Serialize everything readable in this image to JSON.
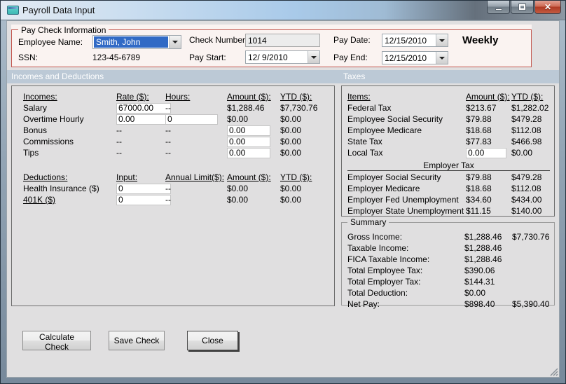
{
  "colors": {
    "selection": "#316AC5",
    "band": "#BCC9D6",
    "groupborder": "#C3574F",
    "groupbg": "#FAF3F1",
    "clientbg": "#E0DFE0"
  },
  "window": {
    "title": "Payroll Data Input"
  },
  "paycheck_info": {
    "legend": "Pay Check Information",
    "employee_name_label": "Employee Name:",
    "employee_name_value": "Smith, John",
    "ssn_label": "SSN:",
    "ssn_value": "123-45-6789",
    "check_number_label": "Check Number:",
    "check_number_value": "1014",
    "pay_start_label": "Pay Start:",
    "pay_start_value": "12/ 9/2010",
    "pay_date_label": "Pay Date:",
    "pay_date_value": "12/15/2010",
    "pay_end_label": "Pay End:",
    "pay_end_value": "12/15/2010",
    "frequency": "Weekly"
  },
  "sections": {
    "incomes_deductions": "Incomes and Deductions",
    "taxes": "Taxes"
  },
  "incomes": {
    "headers": [
      "Incomes:",
      "Rate ($):",
      "Hours:",
      "Amount ($):",
      "YTD ($):"
    ],
    "rows": [
      {
        "name": "Salary",
        "rate": "67000.00",
        "hours": "--",
        "amount": "$1,288.46",
        "ytd": "$7,730.76"
      },
      {
        "name": "Overtime Hourly",
        "rate": "0.00",
        "hours": "0",
        "amount": "$0.00",
        "ytd": "$0.00"
      },
      {
        "name": "Bonus",
        "rate": "--",
        "hours": "--",
        "amount": "0.00",
        "ytd": "$0.00"
      },
      {
        "name": "Commissions",
        "rate": "--",
        "hours": "--",
        "amount": "0.00",
        "ytd": "$0.00"
      },
      {
        "name": "Tips",
        "rate": "--",
        "hours": "--",
        "amount": "0.00",
        "ytd": "$0.00"
      }
    ]
  },
  "deductions": {
    "headers": [
      "Deductions:",
      "Input:",
      "Annual Limit($):",
      "Amount ($):",
      "YTD ($):"
    ],
    "rows": [
      {
        "name": "Health Insurance  ($)",
        "input": "0",
        "annual_limit": "--",
        "amount": "$0.00",
        "ytd": "$0.00"
      },
      {
        "name": "401K  ($)",
        "input": "0",
        "annual_limit": "--",
        "amount": "$0.00",
        "ytd": "$0.00"
      }
    ]
  },
  "taxes": {
    "headers": [
      "Items:",
      "Amount ($):",
      "YTD ($):"
    ],
    "employee_rows": [
      {
        "name": "Federal Tax",
        "amount": "$213.67",
        "ytd": "$1,282.02"
      },
      {
        "name": "Employee Social Security",
        "amount": "$79.88",
        "ytd": "$479.28"
      },
      {
        "name": "Employee Medicare",
        "amount": "$18.68",
        "ytd": "$112.08"
      },
      {
        "name": "State Tax",
        "amount": "$77.83",
        "ytd": "$466.98"
      },
      {
        "name": "Local Tax",
        "amount": "0.00",
        "ytd": "$0.00"
      }
    ],
    "employer_divider": "Employer Tax",
    "employer_rows": [
      {
        "name": "Employer Social Security",
        "amount": "$79.88",
        "ytd": "$479.28"
      },
      {
        "name": "Employer Medicare",
        "amount": "$18.68",
        "ytd": "$112.08"
      },
      {
        "name": "Employer Fed Unemployment",
        "amount": "$34.60",
        "ytd": "$434.00"
      },
      {
        "name": "Employer State Unemployment",
        "amount": "$11.15",
        "ytd": "$140.00"
      }
    ]
  },
  "summary": {
    "legend": "Summary",
    "rows": [
      {
        "name": "Gross Income:",
        "amount": "$1,288.46",
        "ytd": "$7,730.76"
      },
      {
        "name": "Taxable Income:",
        "amount": "$1,288.46",
        "ytd": ""
      },
      {
        "name": "FICA Taxable Income:",
        "amount": "$1,288.46",
        "ytd": ""
      },
      {
        "name": "Total Employee Tax:",
        "amount": "$390.06",
        "ytd": ""
      },
      {
        "name": "Total Employer Tax:",
        "amount": "$144.31",
        "ytd": ""
      },
      {
        "name": "Total Deduction:",
        "amount": "$0.00",
        "ytd": ""
      },
      {
        "name": "Net Pay:",
        "amount": "$898.40",
        "ytd": "$5,390.40"
      }
    ]
  },
  "buttons": {
    "calculate": "Calculate Check",
    "save": "Save Check",
    "close": "Close"
  }
}
